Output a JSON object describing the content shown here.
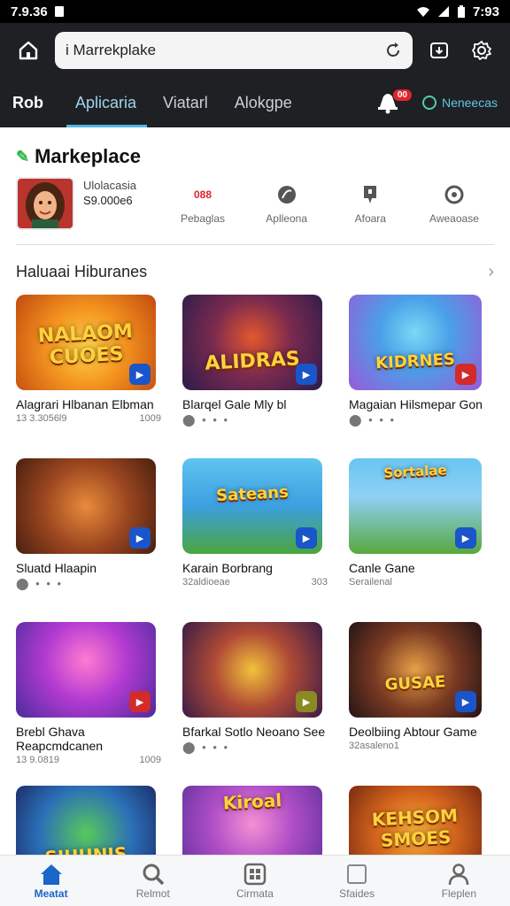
{
  "status": {
    "time_left": "7.9.36",
    "time_right": "7:93"
  },
  "browser": {
    "search_text": "i Marrekplake"
  },
  "tabs": [
    {
      "label": "Rob"
    },
    {
      "label": "Aplicaria"
    },
    {
      "label": "Viatarl"
    },
    {
      "label": "Alokgpe"
    }
  ],
  "notification_badge": "00",
  "right_link": "Neneecas",
  "marketplace": {
    "title": "Markeplace",
    "profile": {
      "name": "Ulolacasia",
      "number": "S9.000e6"
    },
    "stats": [
      {
        "label": "Pebaglas",
        "icon": "ticket-icon",
        "value": "088"
      },
      {
        "label": "Aplleona",
        "icon": "leaf-icon"
      },
      {
        "label": "Afoara",
        "icon": "bookmark-icon"
      },
      {
        "label": "Aweaoase",
        "icon": "circle-icon"
      }
    ]
  },
  "section": {
    "title": "Haluaai Hiburanes"
  },
  "cards": [
    {
      "title": "NALAOM CUOES",
      "name": "Alagrari Hlbanan Elbman",
      "meta_left": "13 3.3056l9",
      "meta_right": "1009",
      "dots": false,
      "play": "blue"
    },
    {
      "title": "ALIDRAS",
      "name": "Blarqel Gale Mly bl",
      "meta_left": "",
      "meta_right": "",
      "dots": true,
      "play": "blue"
    },
    {
      "title": "KIDRNES",
      "name": "Magaian Hilsmepar Gon",
      "meta_left": "",
      "meta_right": "",
      "dots": true,
      "play": "red"
    },
    {
      "title": "",
      "name": "Sluatd Hlaapin",
      "meta_left": "",
      "meta_right": "",
      "dots": true,
      "play": "blue"
    },
    {
      "title": "Sateans",
      "name": "Karain Borbrang",
      "meta_left": "32aldioeae",
      "meta_right": "303",
      "dots": false,
      "play": "blue"
    },
    {
      "title": "Sortalae",
      "name": "Canle Gane",
      "meta_left": "Serailenal",
      "meta_right": "",
      "dots": false,
      "play": "blue"
    },
    {
      "title": "",
      "name": "Brebl Ghava Reapcmdcanen",
      "meta_left": "13 9.0819",
      "meta_right": "1009",
      "dots": false,
      "play": "red"
    },
    {
      "title": "",
      "name": "Bfarkal Sotlo Neoano See",
      "meta_left": "",
      "meta_right": "",
      "dots": true,
      "play": "olive"
    },
    {
      "title": "GUSAE",
      "name": "Deolbiing Abtour Game",
      "meta_left": "32asaleno1",
      "meta_right": "",
      "dots": false,
      "play": "blue"
    },
    {
      "title": "SIUUNIS",
      "name": "",
      "meta_left": "",
      "meta_right": "",
      "dots": false,
      "play": "none"
    },
    {
      "title": "Kiroal",
      "name": "",
      "meta_left": "",
      "meta_right": "",
      "dots": false,
      "play": "none"
    },
    {
      "title": "KEHSOM SMOES",
      "name": "",
      "meta_left": "",
      "meta_right": "",
      "dots": false,
      "play": "none"
    }
  ],
  "bottom_nav": [
    {
      "label": "Meatat",
      "icon": "home-icon"
    },
    {
      "label": "Relmot",
      "icon": "search-icon"
    },
    {
      "label": "Cirmata",
      "icon": "grid-icon"
    },
    {
      "label": "Sfaides",
      "icon": "square-icon"
    },
    {
      "label": "Fleplen",
      "icon": "person-icon"
    }
  ]
}
